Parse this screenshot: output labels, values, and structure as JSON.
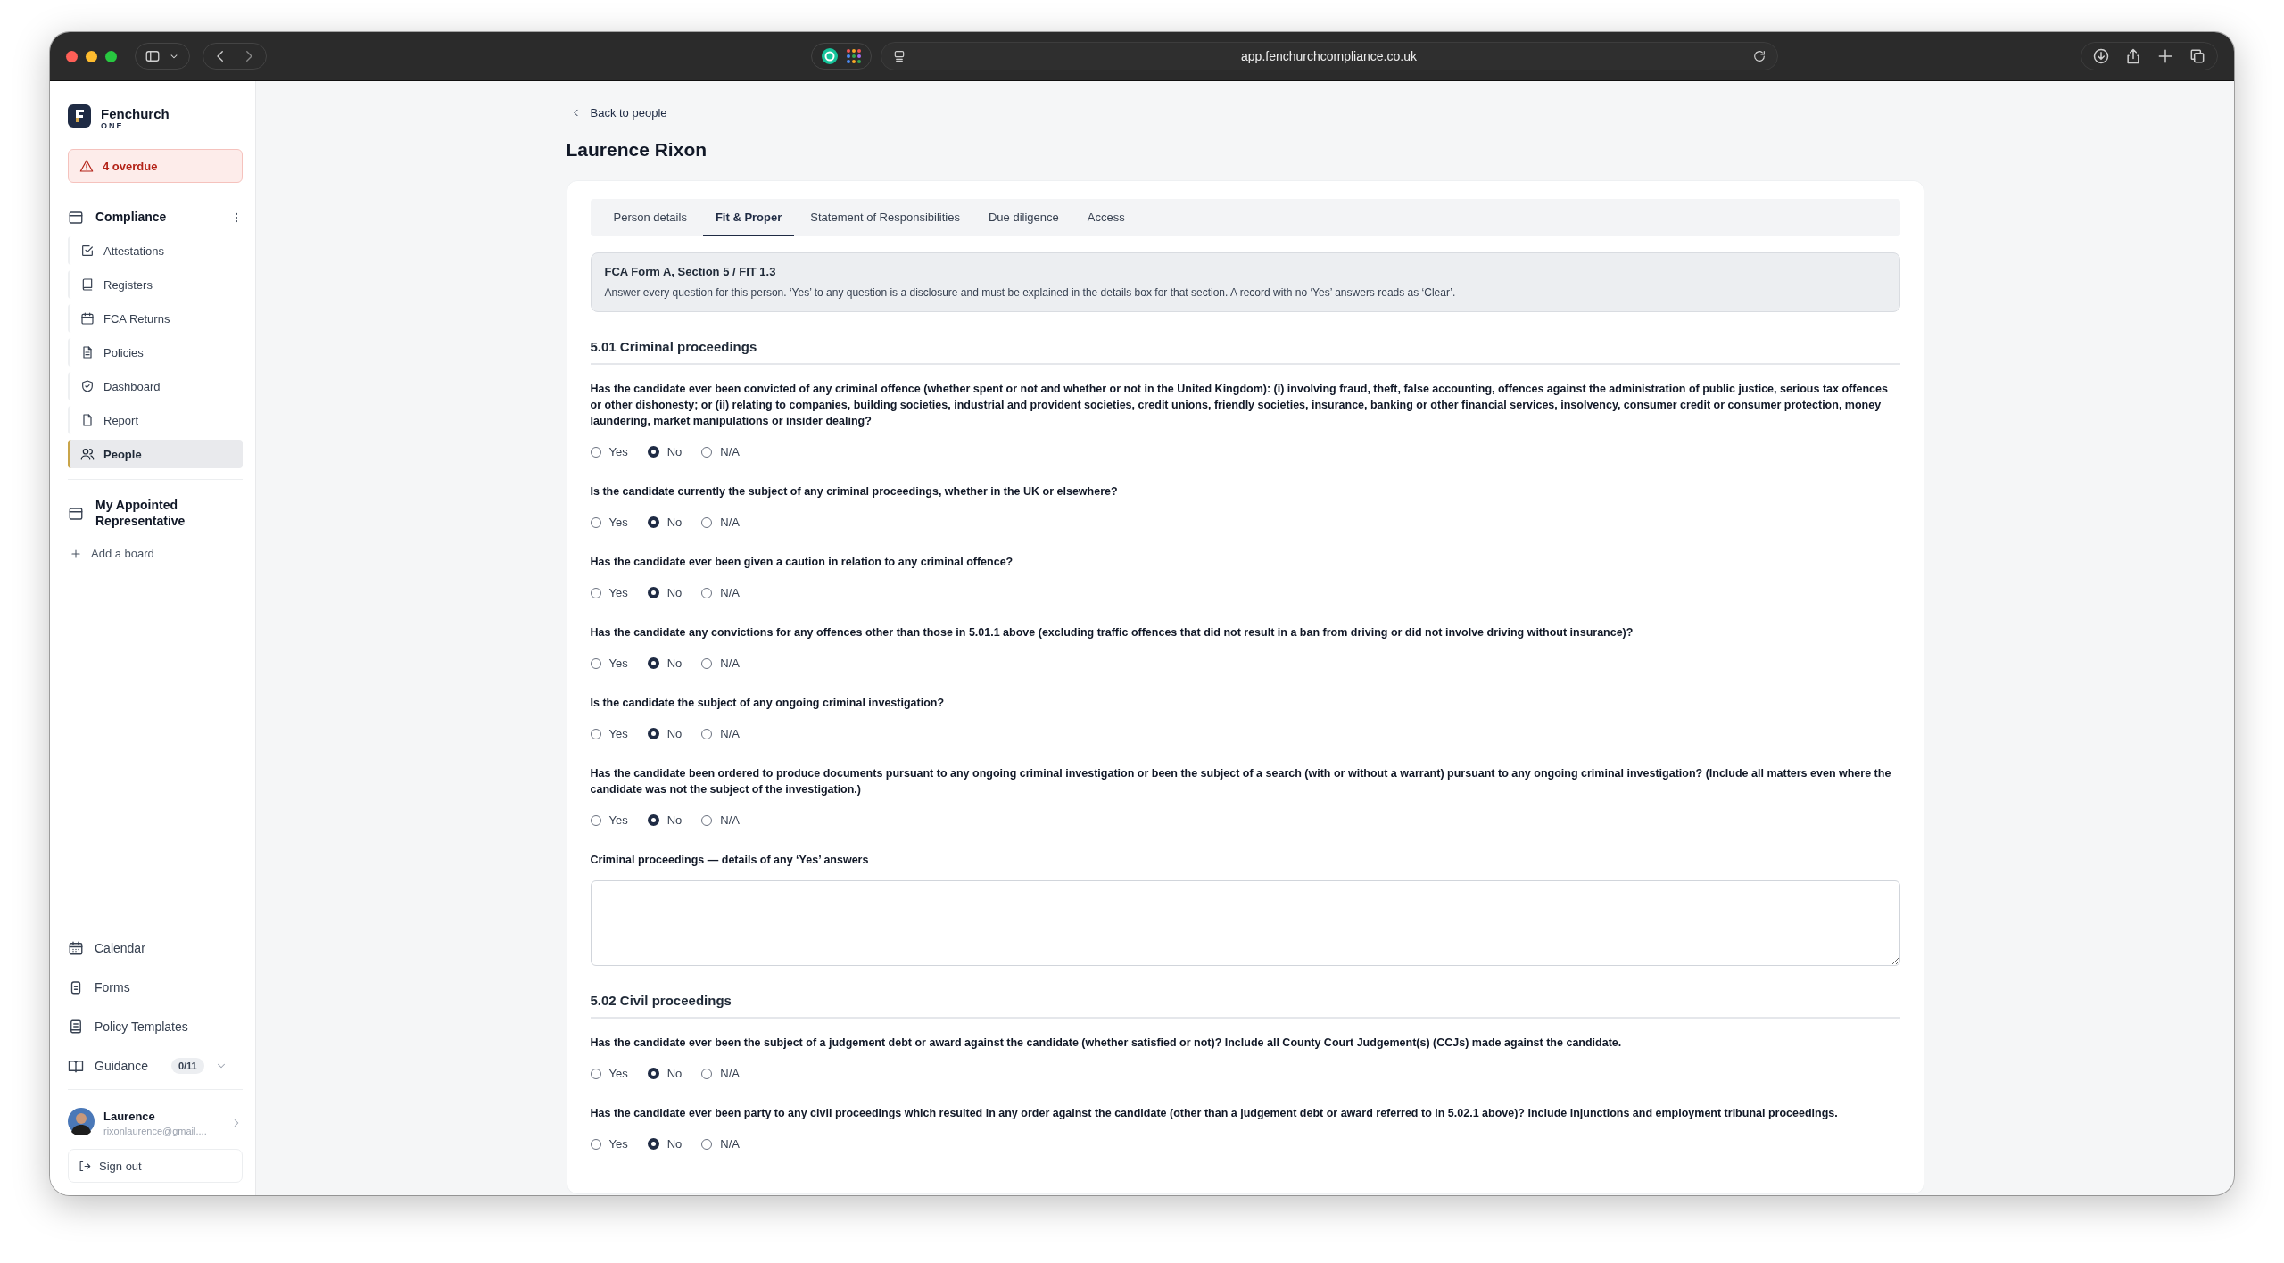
{
  "browser": {
    "url": "app.fenchurchcompliance.co.uk"
  },
  "sidebar": {
    "brand": {
      "name": "Fenchurch",
      "tagline": "ONE"
    },
    "alert": "4 overdue",
    "boards": [
      {
        "title": "Compliance",
        "expanded": true,
        "items": [
          {
            "label": "Attestations",
            "selected": false
          },
          {
            "label": "Registers",
            "selected": false
          },
          {
            "label": "FCA Returns",
            "selected": false
          },
          {
            "label": "Policies",
            "selected": false
          },
          {
            "label": "Dashboard",
            "selected": false
          },
          {
            "label": "Report",
            "selected": false
          },
          {
            "label": "People",
            "selected": true
          }
        ]
      },
      {
        "title": "My Appointed Representative",
        "expanded": false
      }
    ],
    "add_board": "Add a board",
    "links": [
      {
        "label": "Calendar"
      },
      {
        "label": "Forms"
      },
      {
        "label": "Policy Templates"
      },
      {
        "label": "Guidance",
        "badge": "0/11"
      }
    ],
    "user": {
      "name": "Laurence",
      "email": "rixonlaurence@gmail...."
    },
    "sign_out": "Sign out"
  },
  "back_link": "Back to people",
  "title": "Laurence Rixon",
  "tabs": [
    {
      "label": "Person details",
      "selected": false
    },
    {
      "label": "Fit & Proper",
      "selected": true
    },
    {
      "label": "Statement of Responsibilities",
      "selected": false
    },
    {
      "label": "Due diligence",
      "selected": false
    },
    {
      "label": "Access",
      "selected": false
    }
  ],
  "notice": {
    "title": "FCA Form A, Section 5 / FIT 1.3",
    "text": "Answer every question for this person. ‘Yes’ to any question is a disclosure and must be explained in the details box for that section. A record with no ‘Yes’ answers reads as ‘Clear’."
  },
  "sections": [
    {
      "title": "5.01 Criminal proceedings",
      "items": [
        {
          "kind": "question",
          "text": "Has the candidate ever been convicted of any criminal offence (whether spent or not and whether or not in the United Kingdom): (i) involving fraud, theft, false accounting, offences against the administration of public justice, serious tax offences or other dishonesty; or (ii) relating to companies, building societies, industrial and provident societies, credit unions, friendly societies, insurance, banking or other financial services, insolvency, consumer credit or consumer protection, money laundering, market manipulations or insider dealing?",
          "options": [
            {
              "label": "Yes",
              "selected": false
            },
            {
              "label": "No",
              "selected": true
            },
            {
              "label": "N/A",
              "selected": false
            }
          ]
        },
        {
          "kind": "question",
          "text": "Is the candidate currently the subject of any criminal proceedings, whether in the UK or elsewhere?",
          "options": [
            {
              "label": "Yes",
              "selected": false
            },
            {
              "label": "No",
              "selected": true
            },
            {
              "label": "N/A",
              "selected": false
            }
          ]
        },
        {
          "kind": "question",
          "text": "Has the candidate ever been given a caution in relation to any criminal offence?",
          "options": [
            {
              "label": "Yes",
              "selected": false
            },
            {
              "label": "No",
              "selected": true
            },
            {
              "label": "N/A",
              "selected": false
            }
          ]
        },
        {
          "kind": "question",
          "text": "Has the candidate any convictions for any offences other than those in 5.01.1 above (excluding traffic offences that did not result in a ban from driving or did not involve driving without insurance)?",
          "options": [
            {
              "label": "Yes",
              "selected": false
            },
            {
              "label": "No",
              "selected": true
            },
            {
              "label": "N/A",
              "selected": false
            }
          ]
        },
        {
          "kind": "question",
          "text": "Is the candidate the subject of any ongoing criminal investigation?",
          "options": [
            {
              "label": "Yes",
              "selected": false
            },
            {
              "label": "No",
              "selected": true
            },
            {
              "label": "N/A",
              "selected": false
            }
          ]
        },
        {
          "kind": "question",
          "text": "Has the candidate been ordered to produce documents pursuant to any ongoing criminal investigation or been the subject of a search (with or without a warrant) pursuant to any ongoing criminal investigation? (Include all matters even where the candidate was not the subject of the investigation.)",
          "options": [
            {
              "label": "Yes",
              "selected": false
            },
            {
              "label": "No",
              "selected": true
            },
            {
              "label": "N/A",
              "selected": false
            }
          ]
        },
        {
          "kind": "details",
          "label": "Criminal proceedings — details of any ‘Yes’ answers"
        }
      ]
    },
    {
      "title": "5.02 Civil proceedings",
      "items": [
        {
          "kind": "question",
          "text": "Has the candidate ever been the subject of a judgement debt or award against the candidate (whether satisfied or not)? Include all County Court Judgement(s) (CCJs) made against the candidate.",
          "options": [
            {
              "label": "Yes",
              "selected": false
            },
            {
              "label": "No",
              "selected": true
            },
            {
              "label": "N/A",
              "selected": false
            }
          ]
        },
        {
          "kind": "question",
          "text": "Has the candidate ever been party to any civil proceedings which resulted in any order against the candidate (other than a judgement debt or award referred to in 5.02.1 above)? Include injunctions and employment tribunal proceedings.",
          "options": [
            {
              "label": "Yes",
              "selected": false
            },
            {
              "label": "No",
              "selected": true
            },
            {
              "label": "N/A",
              "selected": false
            }
          ]
        }
      ]
    }
  ]
}
